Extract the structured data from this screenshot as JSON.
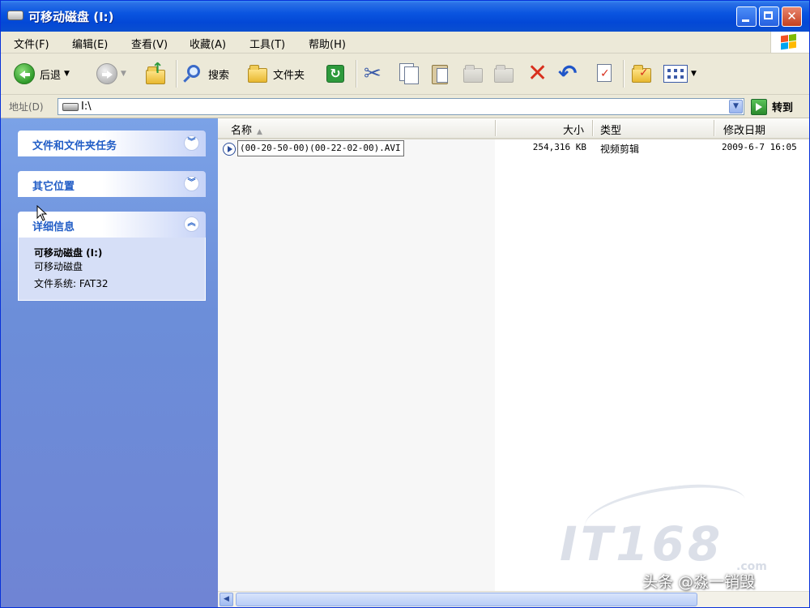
{
  "window": {
    "title": "可移动磁盘 (I:)",
    "controls": {
      "minimize": "minimize",
      "maximize": "maximize",
      "close": "✕"
    }
  },
  "menu": [
    "文件(F)",
    "编辑(E)",
    "查看(V)",
    "收藏(A)",
    "工具(T)",
    "帮助(H)"
  ],
  "toolbar": {
    "back_label": "后退",
    "search_label": "搜索",
    "folders_label": "文件夹"
  },
  "address": {
    "label": "地址(D)",
    "value": "I:\\",
    "go_label": "转到"
  },
  "taskpane": {
    "file_tasks_title": "文件和文件夹任务",
    "other_places_title": "其它位置",
    "details_title": "详细信息",
    "details": {
      "name": "可移动磁盘 (I:)",
      "type": "可移动磁盘",
      "filesystem": "文件系统: FAT32"
    }
  },
  "filelist": {
    "columns": {
      "name": "名称",
      "size": "大小",
      "type": "类型",
      "modified": "修改日期"
    },
    "sorted_by": "name",
    "rows": [
      {
        "name": "(00-20-50-00)(00-22-02-00).AVI",
        "size": "254,316 KB",
        "type": "视频剪辑",
        "modified": "2009-6-7 16:05"
      }
    ]
  },
  "watermark": {
    "logo": "IT168",
    "logo_suffix": ".com",
    "credit": "头条 @淼一销毁"
  },
  "colors": {
    "titlebar": "#0348d6",
    "taskpane": "#6c8ed9",
    "task_title": "#215dc6",
    "chrome": "#ece9d8"
  }
}
